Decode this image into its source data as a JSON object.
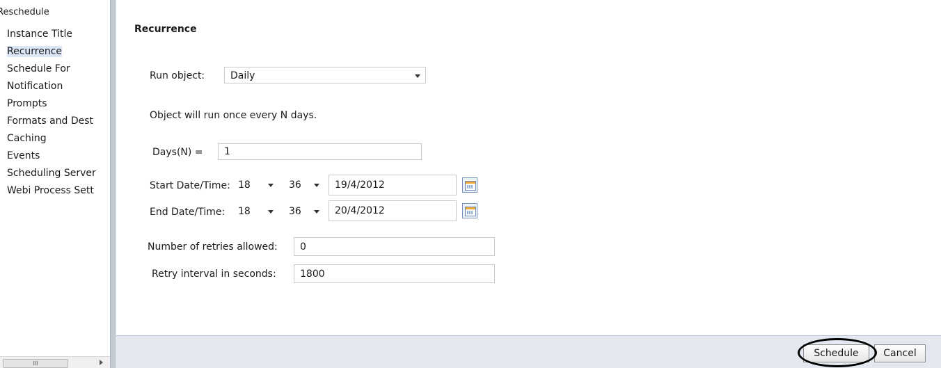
{
  "sidebar": {
    "title": "Reschedule",
    "items": [
      {
        "label": "Instance Title"
      },
      {
        "label": "Recurrence"
      },
      {
        "label": "Schedule For"
      },
      {
        "label": "Notification"
      },
      {
        "label": "Prompts"
      },
      {
        "label": "Formats and Dest"
      },
      {
        "label": "Caching"
      },
      {
        "label": "Events"
      },
      {
        "label": "Scheduling Server"
      },
      {
        "label": "Webi Process Sett"
      }
    ],
    "active_item": "Recurrence",
    "scroll_thumb": "III"
  },
  "recurrence": {
    "heading": "Recurrence",
    "run_object_label": "Run object:",
    "run_object_value": "Daily",
    "description": "Object will run once every N days.",
    "days_label": "Days(N) =",
    "days_value": "1",
    "start_label": "Start Date/Time:",
    "start_hour": "18",
    "start_minute": "36",
    "start_date": "19/4/2012",
    "end_label": "End Date/Time:",
    "end_hour": "18",
    "end_minute": "36",
    "end_date": "20/4/2012",
    "retries_label": "Number of retries allowed:",
    "retries_value": "0",
    "interval_label": "Retry interval in seconds:",
    "interval_value": "1800"
  },
  "footer": {
    "schedule_label": "Schedule",
    "cancel_label": "Cancel"
  },
  "colors": {
    "accent_highlight": "#dbe7f7",
    "footer_bg": "#e4e9f1",
    "splitter": "#c4cad2"
  },
  "icons": {
    "calendar": "calendar-icon",
    "dropdown": "chevron-down-icon"
  }
}
